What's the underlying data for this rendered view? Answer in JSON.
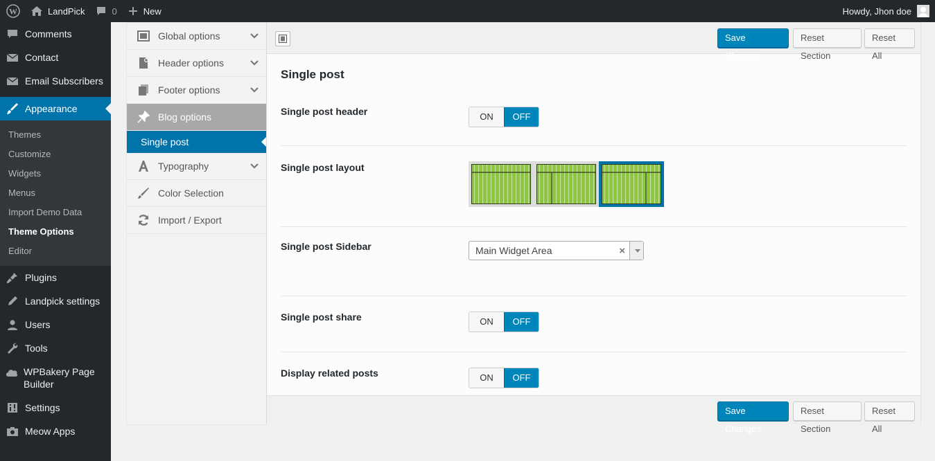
{
  "admin_bar": {
    "site_name": "LandPick",
    "comments_count": "0",
    "new_label": "New",
    "greeting": "Howdy, Jhon doe"
  },
  "sidebar": {
    "top_items": [
      {
        "label": "Comments",
        "icon": "comment-icon"
      },
      {
        "label": "Contact",
        "icon": "mail-icon"
      },
      {
        "label": "Email Subscribers",
        "icon": "mail-icon"
      }
    ],
    "current": {
      "label": "Appearance",
      "icon": "paintbrush-icon"
    },
    "submenu": [
      "Themes",
      "Customize",
      "Widgets",
      "Menus",
      "Import Demo Data",
      "Theme Options",
      "Editor"
    ],
    "submenu_active": "Theme Options",
    "bottom_items": [
      {
        "label": "Plugins",
        "icon": "plug-icon"
      },
      {
        "label": "Landpick settings",
        "icon": "edit-icon"
      },
      {
        "label": "Users",
        "icon": "users-icon"
      },
      {
        "label": "Tools",
        "icon": "wrench-icon"
      },
      {
        "label": "WPBakery Page Builder",
        "icon": "cloud-icon"
      },
      {
        "label": "Settings",
        "icon": "sliders-icon"
      },
      {
        "label": "Meow Apps",
        "icon": "camera-icon"
      }
    ]
  },
  "options_nav": {
    "items": [
      {
        "label": "Global options",
        "icon": "window-icon"
      },
      {
        "label": "Header options",
        "icon": "page-icon"
      },
      {
        "label": "Footer options",
        "icon": "pages-icon"
      },
      {
        "label": "Blog options",
        "icon": "pin-icon"
      },
      {
        "label": "Typography",
        "icon": "font-icon"
      },
      {
        "label": "Color Selection",
        "icon": "brush-icon"
      },
      {
        "label": "Import / Export",
        "icon": "refresh-icon"
      }
    ],
    "active_sub": "Single post"
  },
  "toolbar": {
    "save_label": "Save Changes",
    "reset_section_label": "Reset Section",
    "reset_all_label": "Reset All"
  },
  "section": {
    "title": "Single post",
    "fields": {
      "header": {
        "label": "Single post header",
        "on": "ON",
        "off": "OFF",
        "value": "OFF"
      },
      "layout": {
        "label": "Single post layout",
        "options": [
          "full-width",
          "left-sidebar",
          "right-sidebar"
        ],
        "selected": "right-sidebar"
      },
      "sidebar": {
        "label": "Single post Sidebar",
        "value": "Main Widget Area",
        "clear": "×"
      },
      "share": {
        "label": "Single post share",
        "on": "ON",
        "off": "OFF",
        "value": "OFF"
      },
      "related": {
        "label": "Display related posts",
        "on": "ON",
        "off": "OFF",
        "value": "OFF"
      }
    }
  },
  "colors": {
    "accent": "#0073aa",
    "button_primary": "#0085ba",
    "sidebar_bg": "#23282d",
    "layout_green": "#8dc63f"
  }
}
